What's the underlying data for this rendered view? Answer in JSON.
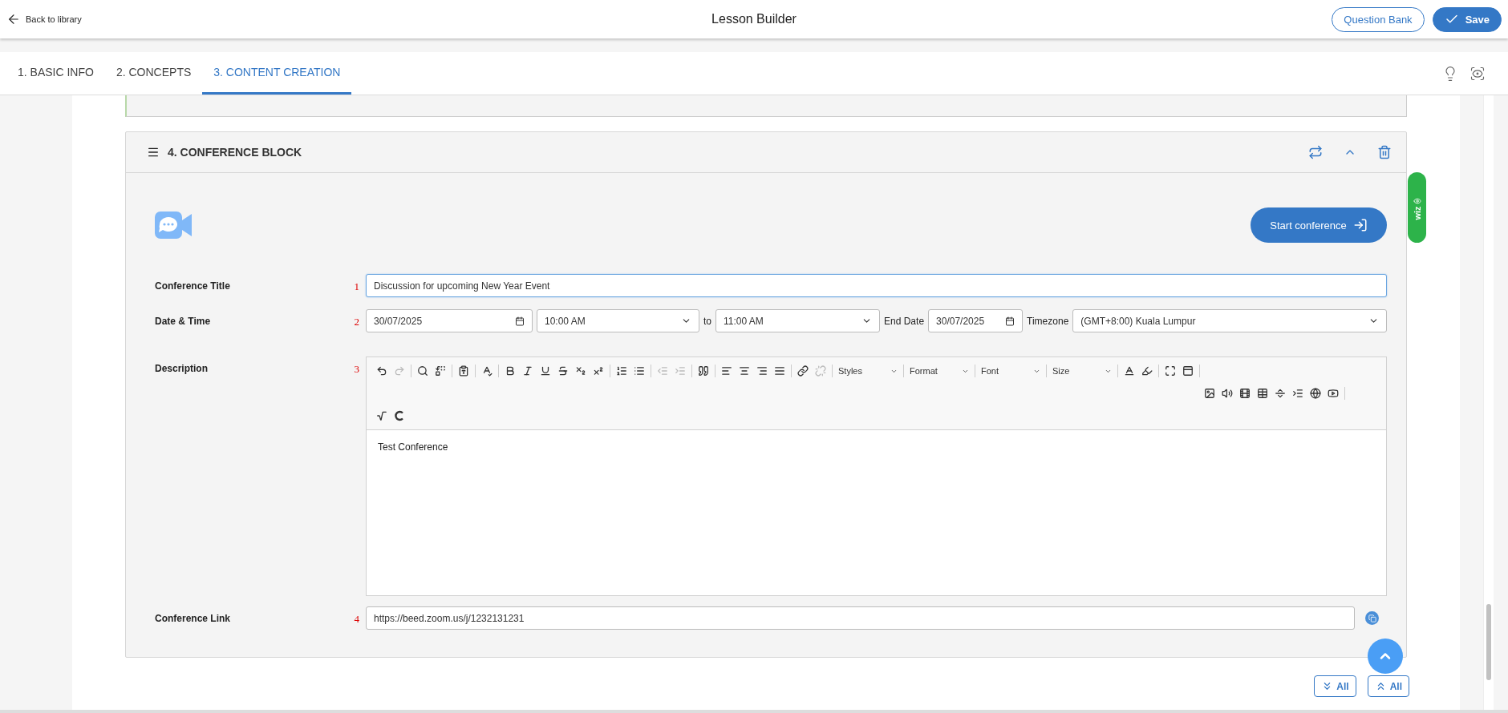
{
  "header": {
    "back": "Back to library",
    "title": "Lesson Builder",
    "buttons": [
      {
        "label": "Question Bank",
        "kind": "outline"
      },
      {
        "label": "Save",
        "kind": "primary"
      }
    ]
  },
  "tabs": [
    {
      "label": "1. BASIC INFO",
      "selected": false
    },
    {
      "label": "2. CONCEPTS",
      "selected": false
    },
    {
      "label": "3. CONTENT CREATION",
      "selected": true
    }
  ],
  "block": {
    "title": "4. CONFERENCE BLOCK",
    "expanded": true,
    "start_button": "Start conference",
    "fields": [
      {
        "kind": "text",
        "label": "Conference Title",
        "marker": "1",
        "value": "Discussion for upcoming New Year Event",
        "focused": true
      },
      {
        "kind": "datetime",
        "label": "Date & Time",
        "marker": "2",
        "date": "30/07/2025",
        "start": "10:00 AM",
        "to": "to",
        "end": "11:00 AM",
        "end_date_label": "End Date",
        "end_date": "30/07/2025",
        "timezone_label": "Timezone",
        "timezone": "(GMT+8:00) Kuala Lumpur"
      },
      {
        "kind": "editor",
        "label": "Description",
        "marker": "3",
        "content": "Test Conference",
        "toolbar": [
          [
            {
              "kind": "icon",
              "disabled": false
            },
            {
              "kind": "icon",
              "disabled": true
            },
            {
              "kind": "sep"
            },
            {
              "kind": "icon",
              "disabled": false
            },
            {
              "kind": "icon",
              "disabled": false
            },
            {
              "kind": "sep"
            },
            {
              "kind": "icon",
              "disabled": false
            },
            {
              "kind": "sep"
            },
            {
              "kind": "icon",
              "disabled": false
            },
            {
              "kind": "sep"
            },
            {
              "kind": "icon",
              "disabled": false
            },
            {
              "kind": "icon",
              "disabled": false
            },
            {
              "kind": "icon",
              "disabled": false
            },
            {
              "kind": "icon",
              "disabled": false
            },
            {
              "kind": "icon",
              "disabled": false
            },
            {
              "kind": "icon",
              "disabled": false
            },
            {
              "kind": "sep"
            },
            {
              "kind": "icon",
              "disabled": false
            },
            {
              "kind": "icon",
              "disabled": false
            },
            {
              "kind": "sep"
            },
            {
              "kind": "icon",
              "disabled": true
            },
            {
              "kind": "icon",
              "disabled": true
            },
            {
              "kind": "sep"
            },
            {
              "kind": "icon",
              "disabled": false
            },
            {
              "kind": "sep"
            },
            {
              "kind": "icon",
              "disabled": false
            },
            {
              "kind": "icon",
              "disabled": false
            },
            {
              "kind": "icon",
              "disabled": false
            },
            {
              "kind": "icon",
              "disabled": false
            },
            {
              "kind": "sep"
            },
            {
              "kind": "icon",
              "disabled": false
            },
            {
              "kind": "icon",
              "disabled": true
            },
            {
              "kind": "sep"
            },
            {
              "kind": "dropdown",
              "label": "Styles"
            },
            {
              "kind": "sep"
            },
            {
              "kind": "dropdown",
              "label": "Format"
            },
            {
              "kind": "sep"
            },
            {
              "kind": "dropdown",
              "label": "Font"
            },
            {
              "kind": "sep"
            },
            {
              "kind": "dropdown",
              "label": "Size"
            },
            {
              "kind": "sep"
            },
            {
              "kind": "icon",
              "disabled": false
            },
            {
              "kind": "icon",
              "disabled": false
            },
            {
              "kind": "sep"
            },
            {
              "kind": "icon",
              "disabled": false
            },
            {
              "kind": "icon",
              "disabled": false
            },
            {
              "kind": "sep"
            }
          ],
          [
            {
              "kind": "icon",
              "disabled": false
            },
            {
              "kind": "icon",
              "disabled": false
            },
            {
              "kind": "icon",
              "disabled": false
            },
            {
              "kind": "icon",
              "disabled": false
            },
            {
              "kind": "icon",
              "disabled": false
            },
            {
              "kind": "icon",
              "disabled": false
            },
            {
              "kind": "icon",
              "disabled": false
            },
            {
              "kind": "icon",
              "disabled": false
            },
            {
              "kind": "sep"
            }
          ],
          [
            {
              "kind": "icon",
              "disabled": false
            },
            {
              "kind": "icon",
              "disabled": false
            }
          ]
        ]
      },
      {
        "kind": "link",
        "label": "Conference Link",
        "marker": "4",
        "value": "https://beed.zoom.us/j/1232131231"
      }
    ]
  },
  "side_tab": {
    "label": "wiz"
  },
  "footer_buttons": [
    {
      "label": "All",
      "kind": "expand"
    },
    {
      "label": "All",
      "kind": "collapse"
    }
  ]
}
